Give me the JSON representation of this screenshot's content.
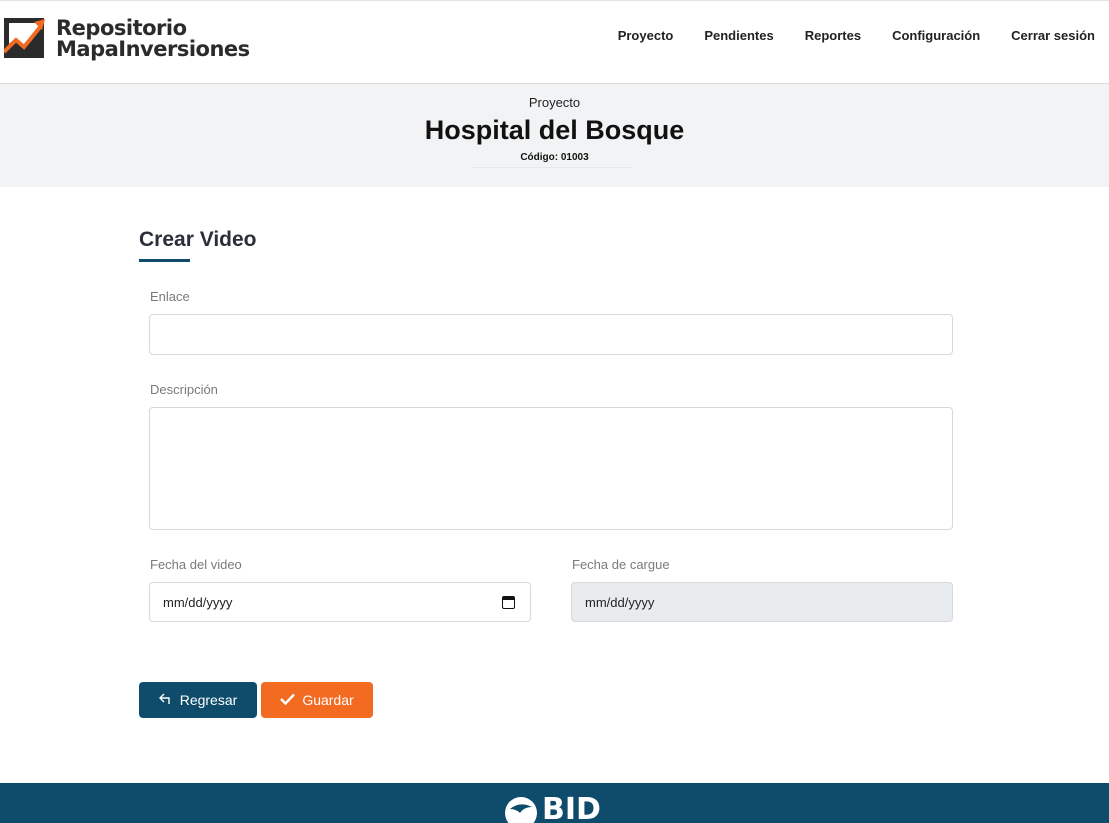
{
  "brand": {
    "name_line1": "Repositorio",
    "name_line2": "MapaInversiones",
    "accent_color": "#f26b21",
    "dark_color": "#2b2b2b"
  },
  "nav": {
    "items": [
      {
        "label": "Proyecto"
      },
      {
        "label": "Pendientes"
      },
      {
        "label": "Reportes"
      },
      {
        "label": "Configuración"
      },
      {
        "label": "Cerrar sesión"
      }
    ]
  },
  "project": {
    "label": "Proyecto",
    "title": "Hospital del Bosque",
    "code": "Código: 01003"
  },
  "form": {
    "title": "Crear Video",
    "link": {
      "label": "Enlace",
      "value": ""
    },
    "description": {
      "label": "Descripción",
      "value": ""
    },
    "video_date": {
      "label": "Fecha del video",
      "value": "mm/dd/yyyy",
      "icon": "calendar-icon"
    },
    "upload_date": {
      "label": "Fecha de cargue",
      "value": "mm/dd/yyyy",
      "disabled": true
    }
  },
  "buttons": {
    "back": {
      "label": "Regresar",
      "icon": "return-arrow-icon",
      "color": "#0f4c6b"
    },
    "save": {
      "label": "Guardar",
      "icon": "check-icon",
      "color": "#f26b21"
    }
  },
  "footer": {
    "logo_text": "BID",
    "color": "#0f4c6b"
  }
}
